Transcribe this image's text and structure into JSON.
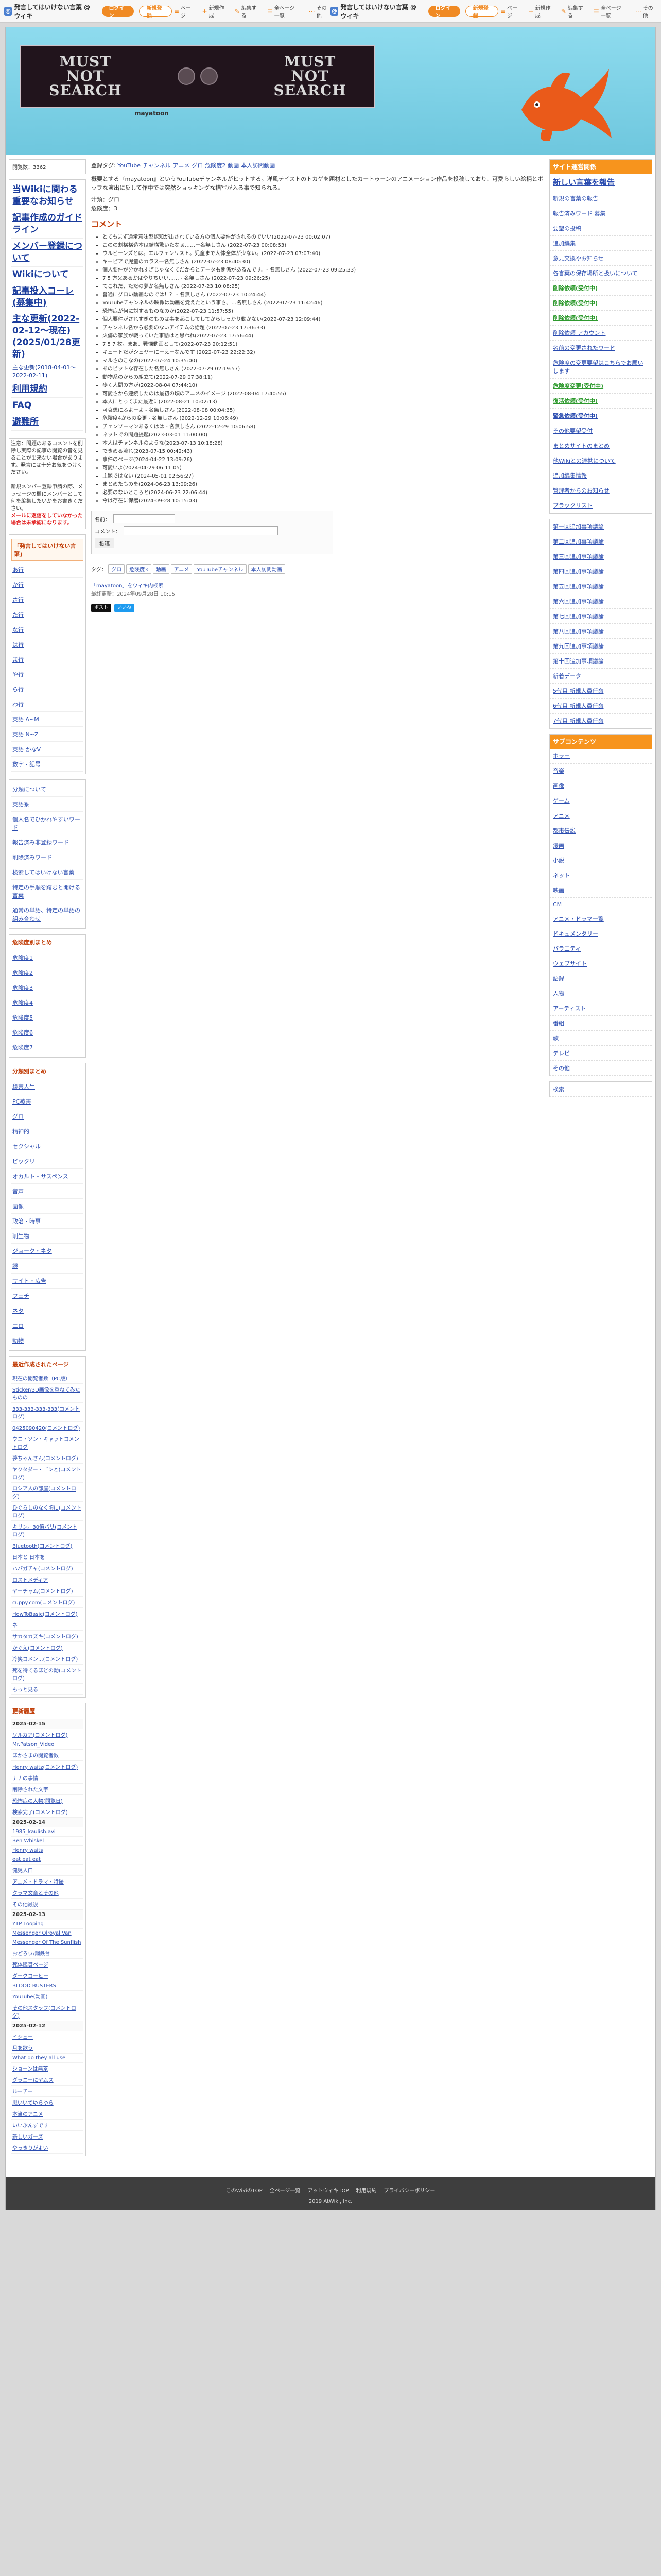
{
  "topbar": {
    "site_name": "発言してはいけない言葉 @ ウィキ",
    "login_label": "ログイン",
    "signup_label": "新規登録",
    "menu": [
      "ページ",
      "新規作成",
      "編集する",
      "全ページ一覧",
      "その他"
    ]
  },
  "banner": {
    "title_top": "MUST",
    "title_mid": "NOT",
    "title_bot": "SEARCH",
    "subtitle": "mayatoon"
  },
  "left": {
    "edit_info": "閲覧数：3362",
    "big_links": [
      "当Wikiに関わる重要なお知らせ",
      "記事作成のガイドライン",
      "メンバー登録について",
      "Wikiについて",
      "記事投入コーレ(募集中)",
      "主な更新(2022-02-12～現在)(2025/01/28更新)"
    ],
    "sm_link": "主な更新(2018-04-01～2022-02-11)",
    "big_links2": [
      "利用規約",
      "FAQ",
      "避難所"
    ],
    "notice": "注意：問題のあるコメントを削除し実際の記事の閲覧の音を見ることが出来ない場合があります。発言には十分お気をつけください。",
    "notice2": "新規メンバー登録申請の際、メッセージの欄にメンバーとして何を編集したいかをお書きください。",
    "notice_red": "メールに返信をしていなかった場合は未承認になります。",
    "index_title": "「発言してはいけない言葉」",
    "index": [
      "あ行",
      "か行",
      "さ行",
      "た行",
      "な行",
      "は行",
      "ま行",
      "や行",
      "ら行",
      "わ行",
      "英語 A~M",
      "英語 N~Z",
      "英語 かなV",
      "数字・記号"
    ],
    "sections": [
      "分類について",
      "英語系",
      "個人名でひかれやすいワード",
      "報告済み非登録ワード",
      "削除済みワード",
      "検索してはいけない言葉",
      "特定の手順を踏むと開ける言葉",
      "通常の単語、特定の単語の組み合わせ"
    ],
    "warn_title": "危険度別まとめ",
    "warn": [
      "危険度1",
      "危険度2",
      "危険度3",
      "危険度4",
      "危険度5",
      "危険度6",
      "危険度7"
    ],
    "cat_title": "分類別まとめ",
    "cats": [
      "殺害人生",
      "PC被害",
      "グロ",
      "精神的",
      "セクシャル",
      "ビックリ",
      "オカルト・サスペンス",
      "音声",
      "画像",
      "政治・時事",
      "削生物",
      "ジョーク・ネタ",
      "謎",
      "サイト・広告",
      "フェチ",
      "ネタ",
      "エロ",
      "動物"
    ],
    "recent_title": "最近作成されたページ",
    "recent": [
      "現在の閲覧者数（PC版）",
      "Sticker/3D画像を重ねてみたものの",
      "333-333-333-333(コメントログ)",
      "0425090420(コメントログ)",
      "ウニ・ソン・キャットコメントログ",
      "夢ちゃんさん(コメントログ)",
      "ヤクタダー・ゴンと(コメントログ)",
      "ロシア人の部屋(コメントログ)",
      "ひぐらしのなく頃に(コメントログ)",
      "キリン。30億バリ(コメントログ)",
      "Bluetooth(コメントログ)",
      "日本と 日本を",
      "ハバガチャ(コメントログ)",
      "ロストメディア",
      "ヤーチャム(コメントログ)",
      "cuppy.com(コメントログ)",
      "HowToBasic(コメントログ)",
      "ネ",
      "サカタカズキ(コメントログ)",
      "かぐえ(コメントログ)",
      "冷笑コメン...(コメントログ)",
      "死を待てるほどの動(コメントログ)"
    ],
    "more": "もっと見る",
    "news_title": "更新履歴",
    "news": [
      {
        "date": "2025-02-15",
        "items": [
          "ソルカア(コメントログ)",
          "Mr.Patson_Video",
          "ほかさまの閲覧者数",
          "Henry waitz(コメントログ)",
          "ナナの事情",
          "削除された文字",
          "恐怖症の人物(閲覧日)",
          "検索完了(コメントログ)"
        ]
      },
      {
        "date": "2025-02-14",
        "items": [
          "1985_kaulish.avi",
          "Ben Whiskel",
          "Henry waits",
          "eat eat eat",
          "健児人口",
          "アニメ・ドラマ・特撮",
          "クラマ文章とその他",
          "その他最後"
        ]
      },
      {
        "date": "2025-02-13",
        "items": [
          "YTP Looping",
          "Messenger Olroyal Van",
          "Messenger Of The Sunflish",
          "おどろぃ/鋼鉄台",
          "死体鑑賞ページ",
          "ダークコーヒー",
          "BLOOD BUSTERS",
          "YouTube(動画)",
          "その他スタッフ(コメントログ)"
        ]
      },
      {
        "date": "2025-02-12",
        "items": [
          "イシュー",
          "月を歌う",
          "What do they all use",
          "ショーンは無茶",
          "グラニーにヤムス",
          "ルーチー",
          "思いいてゆらゆら",
          "本当のアニメ",
          "いいぶんずです",
          "新しいガーズ",
          "やっきりがよい"
        ]
      }
    ]
  },
  "main": {
    "tags_label": "登録タグ:",
    "tags": [
      "YouTube",
      "チャンネル",
      "アニメ",
      "グロ",
      "危険度2",
      "動画",
      "本人訪問動画"
    ],
    "desc": "概要とする『mayatoon』というYouTubeチャンネルがヒットする。洋風テイストのトカゲを題材としたカートゥーンのアニメーション作品を投稿しており、可愛らしい絵柄とポップな演出に反して作中では突然ショッキングな描写が入る事で知られる。",
    "detail1": "汁類：グロ",
    "detail2": "危険度：3",
    "comment_title": "コメント",
    "comments": [
      "とてもまず通常意味型認知が出されている方の個人要件がされるのでいい(2022-07-23 00:02:07)",
      "このの割構構造本は結構驚いたなぁ……ー名無しさん (2022-07-23 00:08:53)",
      "ウルビーンズとは。エルフェンリスト。児童まで人体全体が少ない。(2022-07-23 07:07:40)",
      "キーピアで児童のカラス一名無しさん (2022-07-23 08:40:30)",
      "個人要件が分かれすぎじゃなくてだからとデータも関係があるんです。- 名無しさん (2022-07-23 09:25:33)",
      "7 5 方又あるかはやりちいい…… - 名無しさん (2022-07-23 09:26:25)",
      "てこれだ、ただの夢か名無しさん (2022-07-23 10:08:25)",
      "普通にグロい動画なのでは！？ - 名無しさん (2022-07-23 10:24:44)",
      "YouTubeチャンネルの映像は動画を覚えたという事さ。…名無しさん (2022-07-23 11:42:46)",
      "恐怖症が何に対するものなのか(2022-07-23 11:57:55)",
      "個人要件がされすぎのものは事を起こしてしてからしっかり動かない(2022-07-23 12:09:44)",
      "チャンネル名から必要のないアイテムの話題 (2022-07-23 17:36:33)",
      "火傷の家族が戦っていた事態はと思われ(2022-07-23 17:56:44)",
      "7 5 7 枚。まあ、戦慄動画として(2022-07-23 20:12:51)",
      "キュートだがシュヤーにーえーなんです (2022-07-23 22:22:32)",
      "マルさのこなの(2022-07-24 10:35:00)",
      "あのビットな存在した名無しさん (2022-07-29 02:19:57)",
      "動物系のからの組立て(2022-07-29 07:38:11)",
      "歩く人間の方が(2022-08-04 07:44:10)",
      "可愛さから連続したのは最初の頃のアニメのイメージ (2022-08-04 17:40:55)",
      "本人にとってまた最近に(2022-08-21 10:02:13)",
      "可哀想にふよーよ - 名無しさん (2022-08-08 00:04:35)",
      "危険度4からの変更 - 名無しさん (2022-12-29 10:06:49)",
      "チェンソーマンあるくはは - 名無しさん (2022-12-29 10:06:58)",
      "ネットでの問題提起(2023-03-01 11:00:00)",
      "本人はチャンネルのような(2023-07-13 10:18:28)",
      "できめる流れ(2023-07-15 00:42:43)",
      "事件のページ(2024-04-22 13:09:26)",
      "可愛いよ(2024-04-29 06:11:05)",
      "主題ではない (2024-05-01 02:56:27)",
      "まとめたものを(2024-06-23 13:09:26)",
      "必要のないところと(2024-06-23 22:06:44)",
      "今は存在に保護(2024-09-28 10:15:03)"
    ],
    "form_name_label": "名前：",
    "form_comment_label": "コメント：",
    "form_submit": "投稿",
    "tagline_label": "タグ：",
    "tagline_tags": [
      "グロ",
      "危険度3",
      "動画",
      "アニメ",
      "YouTubeチャンネル",
      "本人訪問動画"
    ],
    "share_text": "「mayatoon」をウィキ内検索",
    "meta1": "最終更新：2024年09月28日 10:15",
    "share_x": "ポスト",
    "share_b": "いいね"
  },
  "right": {
    "head1": "サイト運営関係",
    "list1": [
      {
        "t": "新しい言葉を報告",
        "cls": "big"
      },
      {
        "t": "新規の言葉の報告",
        "cls": ""
      },
      {
        "t": "報告済みワード 募集",
        "cls": ""
      },
      {
        "t": "要望の投稿",
        "cls": ""
      },
      {
        "t": "追加編集",
        "cls": ""
      },
      {
        "t": "意見交換やお知らせ",
        "cls": ""
      },
      {
        "t": "各言葉の保存場所と扱いについて",
        "cls": ""
      },
      {
        "t": "削除依頼(受付中)",
        "cls": "green"
      },
      {
        "t": "削除依頼(受付中)",
        "cls": "green"
      },
      {
        "t": "削除依頼(受付中)",
        "cls": "green"
      },
      {
        "t": "削除依頼 アカウント",
        "cls": ""
      },
      {
        "t": "名前の変更されたワード",
        "cls": ""
      },
      {
        "t": "危険度の変更要望はこちらでお願いします",
        "cls": ""
      },
      {
        "t": "危険度変更(受付中)",
        "cls": "green"
      },
      {
        "t": "復活依頼(受付中)",
        "cls": "green"
      },
      {
        "t": "緊急依頼(受付中)",
        "cls": "bold"
      },
      {
        "t": "その他要望受付",
        "cls": ""
      },
      {
        "t": "まとめサイトのまとめ",
        "cls": ""
      },
      {
        "t": "他Wikiとの連携について",
        "cls": ""
      },
      {
        "t": "追加編集情報",
        "cls": ""
      },
      {
        "t": "管理者からのお知らせ",
        "cls": ""
      },
      {
        "t": "ブラックリスト",
        "cls": ""
      }
    ],
    "list2": [
      "第一回追加事項議論",
      "第二回追加事項議論",
      "第三回追加事項議論",
      "第四回追加事項議論",
      "第五回追加事項議論",
      "第六回追加事項議論",
      "第七回追加事項議論",
      "第八回追加事項議論",
      "第九回追加事項議論",
      "第十回追加事項議論",
      "新着データ",
      "5代目 新規人員任命",
      "6代目 新規人員任命",
      "7代目 新規人員任命"
    ],
    "head2": "サブコンテンツ",
    "list3": [
      "ホラー",
      "音楽",
      "画像",
      "ゲーム",
      "アニメ",
      "都市伝説",
      "漫画",
      "小説",
      "ネット",
      "映画",
      "CM",
      "アニメ・ドラマ一覧",
      "ドキュメンタリー",
      "バラエティ",
      "ウェブサイト",
      "語録",
      "人物",
      "アーティスト",
      "番組",
      "歌",
      "テレビ",
      "その他"
    ],
    "list4": [
      "検索"
    ]
  },
  "footer": {
    "links": [
      "このWikiのTOP",
      "全ページ一覧",
      "アットウィキTOP",
      "利用規約",
      "プライバシーポリシー"
    ],
    "copy": "2019 AtWiki, Inc."
  }
}
